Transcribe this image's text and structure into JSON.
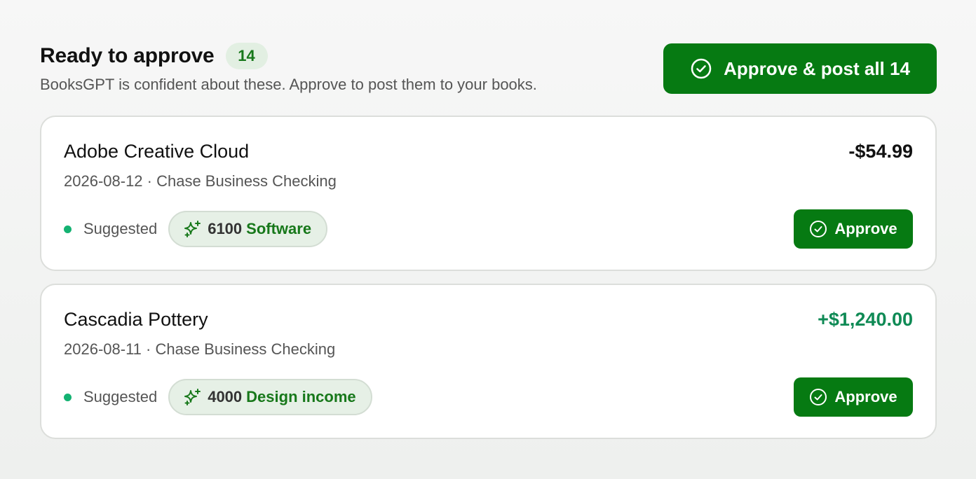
{
  "header": {
    "title": "Ready to approve",
    "count": "14",
    "subtitle": "BooksGPT is confident about these. Approve to post them to your books.",
    "approve_all_label": "Approve & post all 14",
    "approve_all_icon": "check-circle-icon"
  },
  "transactions": [
    {
      "title": "Adobe Creative Cloud",
      "meta": "2026-08-12 · Chase Business Checking",
      "amount": "-$54.99",
      "amount_sign": "negative",
      "status": "Suggested",
      "category_code": "6100",
      "category_name": "Software",
      "category_icon": "sparkle-icon",
      "approve_label": "Approve",
      "approve_icon": "check-circle-icon"
    },
    {
      "title": "Cascadia Pottery",
      "meta": "2026-08-11 · Chase Business Checking",
      "amount": "+$1,240.00",
      "amount_sign": "positive",
      "status": "Suggested",
      "category_code": "4000",
      "category_name": "Design income",
      "category_icon": "sparkle-icon",
      "approve_label": "Approve",
      "approve_icon": "check-circle-icon"
    }
  ],
  "colors": {
    "primary_green": "#067a12",
    "badge_bg": "#e2efe2",
    "status_dot": "#14b272",
    "positive_amount": "#0f8a55"
  }
}
